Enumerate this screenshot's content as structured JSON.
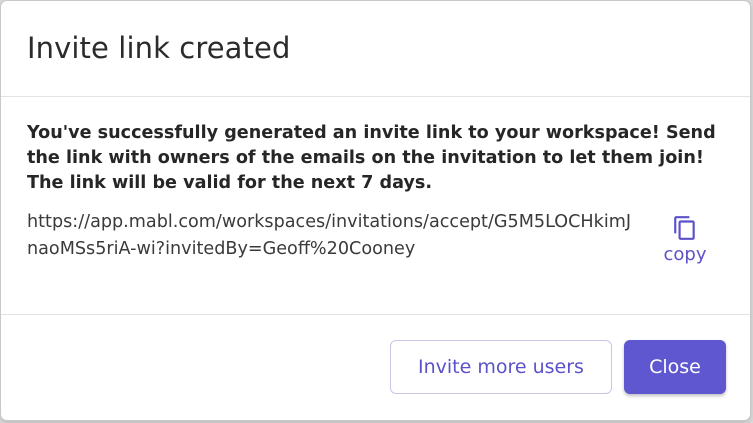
{
  "dialog": {
    "title": "Invite link created",
    "message": "You've successfully generated an invite link to your workspace! Send the link with owners of the emails on the invitation to let them join! The link will be valid for the next 7 days.",
    "invite_link": "https://app.mabl.com/workspaces/invitations/accept/G5M5LOCHkimJnaoMSs5riA-wi?invitedBy=Geoff%20Cooney",
    "copy": {
      "icon": "copy-icon",
      "label": "copy"
    },
    "buttons": {
      "invite_more_label": "Invite more users",
      "close_label": "Close"
    }
  },
  "colors": {
    "accent": "#5f57cf",
    "accent_text": "#5b52c9",
    "secondary_border": "#c9c6ea",
    "title_text": "#2b2b2b",
    "divider": "#e3e3e3"
  }
}
